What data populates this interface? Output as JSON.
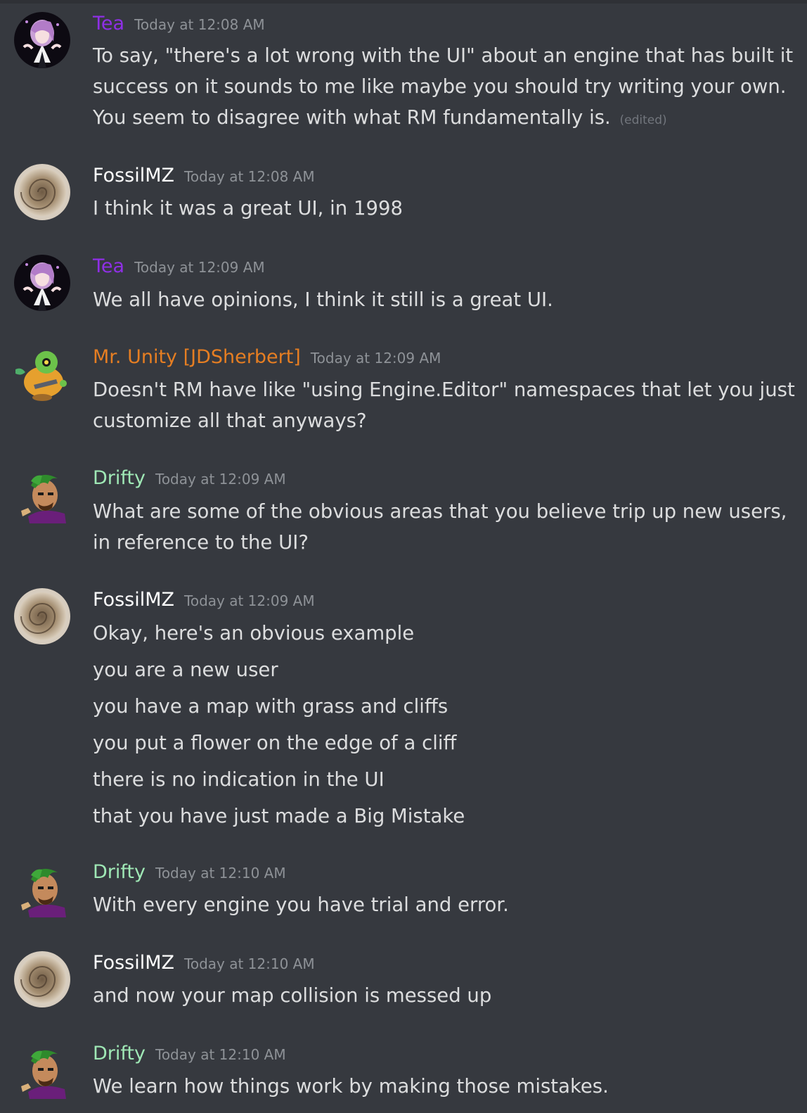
{
  "colors": {
    "background": "#36393f",
    "tea": "#8f2fe6",
    "fossil": "#ffffff",
    "unity": "#e67e22",
    "drifty": "#9fe8b5",
    "timestamp": "#8e9297",
    "text": "#dcddde"
  },
  "messages": [
    {
      "author": "Tea",
      "timestamp": "Today at 12:08 AM",
      "text": "To say, \"there's a lot wrong with the UI\" about an engine that has built it success on it sounds to me like maybe you should try writing your own. You seem to disagree with what RM fundamentally is.",
      "edited": "(edited)",
      "avatar_icon": "anime-girl-avatar"
    },
    {
      "author": "FossilMZ",
      "timestamp": "Today at 12:08 AM",
      "text": "I think it was a great UI, in 1998",
      "avatar_icon": "ammonite-fossil-avatar"
    },
    {
      "author": "Tea",
      "timestamp": "Today at 12:09 AM",
      "text": "We all have opinions, I think it still is a great UI.",
      "avatar_icon": "anime-girl-avatar"
    },
    {
      "author": "Mr. Unity [JDSherbert]",
      "timestamp": "Today at 12:09 AM",
      "text": "Doesn't RM have like \"using Engine.Editor\" namespaces that let you just customize all that anyways?",
      "avatar_icon": "tonberry-avatar"
    },
    {
      "author": "Drifty",
      "timestamp": "Today at 12:09 AM",
      "text": "What are some of the obvious areas that you believe trip up new users, in reference to the UI?",
      "avatar_icon": "green-haired-character-avatar"
    },
    {
      "author": "FossilMZ",
      "timestamp": "Today at 12:09 AM",
      "lines": [
        "Okay, here's an obvious example",
        "you are a new user",
        "you have a map with grass and cliffs",
        "you put a flower on the edge of a cliff",
        "there is no indication in the UI",
        "that you have just made a Big Mistake"
      ],
      "avatar_icon": "ammonite-fossil-avatar"
    },
    {
      "author": "Drifty",
      "timestamp": "Today at 12:10 AM",
      "text": "With every engine you have trial and error.",
      "avatar_icon": "green-haired-character-avatar"
    },
    {
      "author": "FossilMZ",
      "timestamp": "Today at 12:10 AM",
      "text": "and now your map collision is messed up",
      "avatar_icon": "ammonite-fossil-avatar"
    },
    {
      "author": "Drifty",
      "timestamp": "Today at 12:10 AM",
      "text": "We learn how things work by making those mistakes.",
      "avatar_icon": "green-haired-character-avatar"
    }
  ]
}
